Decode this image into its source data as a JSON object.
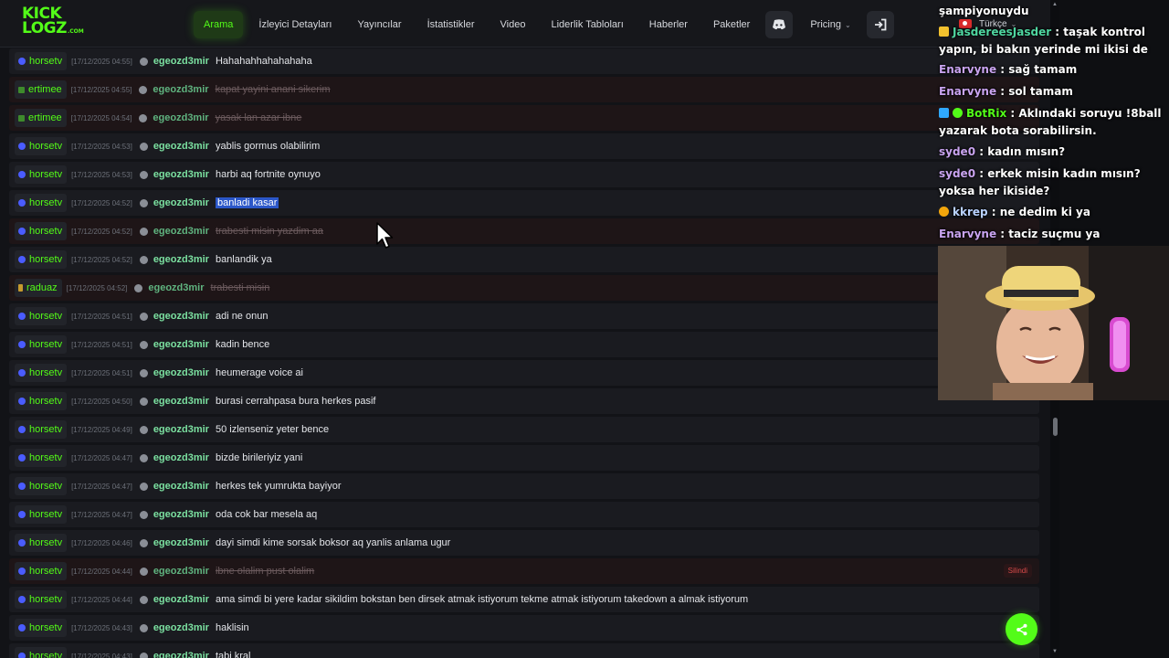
{
  "site": {
    "logo": {
      "line1": "KICK",
      "line2": "LOGZ",
      "suffix": ".COM"
    },
    "nav": [
      {
        "label": "Arama",
        "active": true
      },
      {
        "label": "İzleyici Detayları"
      },
      {
        "label": "Yayıncılar"
      },
      {
        "label": "İstatistikler"
      },
      {
        "label": "Video"
      },
      {
        "label": "Liderlik Tabloları"
      },
      {
        "label": "Haberler"
      },
      {
        "label": "Paketler"
      }
    ],
    "nav_pricing": "Pricing",
    "language": "Türkçe",
    "deleted_label": "Silindi",
    "icons": {
      "discord": "discord-icon",
      "login": "login-icon",
      "share": "share-icon",
      "info": "info-icon"
    }
  },
  "messages": [
    {
      "channel": "horsetv",
      "time": "[17/12/2025 04:55]",
      "user": "egeozd3mir",
      "text": "Hahahahhahahahaha",
      "deleted": false
    },
    {
      "channel": "ertimee",
      "time": "[17/12/2025 04:55]",
      "user": "egeozd3mir",
      "text": "kapat yayini anani sikerim",
      "deleted": true
    },
    {
      "channel": "ertimee",
      "time": "[17/12/2025 04:54]",
      "user": "egeozd3mir",
      "text": "yasak lan azar ibne",
      "deleted": true
    },
    {
      "channel": "horsetv",
      "time": "[17/12/2025 04:53]",
      "user": "egeozd3mir",
      "text": "yablis gormus olabilirim",
      "deleted": false
    },
    {
      "channel": "horsetv",
      "time": "[17/12/2025 04:53]",
      "user": "egeozd3mir",
      "text": "harbi aq fortnite oynuyo",
      "deleted": false
    },
    {
      "channel": "horsetv",
      "time": "[17/12/2025 04:52]",
      "user": "egeozd3mir",
      "text": "banladi kasar",
      "deleted": false,
      "highlight": true
    },
    {
      "channel": "horsetv",
      "time": "[17/12/2025 04:52]",
      "user": "egeozd3mir",
      "text": "trabesti misin yazdim aa",
      "deleted": true
    },
    {
      "channel": "horsetv",
      "time": "[17/12/2025 04:52]",
      "user": "egeozd3mir",
      "text": "banlandik ya",
      "deleted": false
    },
    {
      "channel": "raduaz",
      "time": "[17/12/2025 04:52]",
      "user": "egeozd3mir",
      "text": "trabesti misin",
      "deleted": true
    },
    {
      "channel": "horsetv",
      "time": "[17/12/2025 04:51]",
      "user": "egeozd3mir",
      "text": "adi ne onun",
      "deleted": false
    },
    {
      "channel": "horsetv",
      "time": "[17/12/2025 04:51]",
      "user": "egeozd3mir",
      "text": "kadin bence",
      "deleted": false
    },
    {
      "channel": "horsetv",
      "time": "[17/12/2025 04:51]",
      "user": "egeozd3mir",
      "text": "heumerage voice ai",
      "deleted": false
    },
    {
      "channel": "horsetv",
      "time": "[17/12/2025 04:50]",
      "user": "egeozd3mir",
      "text": "burasi cerrahpasa bura herkes pasif",
      "deleted": false
    },
    {
      "channel": "horsetv",
      "time": "[17/12/2025 04:49]",
      "user": "egeozd3mir",
      "text": "50 izlenseniz yeter bence",
      "deleted": false
    },
    {
      "channel": "horsetv",
      "time": "[17/12/2025 04:47]",
      "user": "egeozd3mir",
      "text": "bizde birileriyiz yani",
      "deleted": false
    },
    {
      "channel": "horsetv",
      "time": "[17/12/2025 04:47]",
      "user": "egeozd3mir",
      "text": "herkes tek yumrukta bayiyor",
      "deleted": false
    },
    {
      "channel": "horsetv",
      "time": "[17/12/2025 04:47]",
      "user": "egeozd3mir",
      "text": "oda cok bar mesela aq",
      "deleted": false
    },
    {
      "channel": "horsetv",
      "time": "[17/12/2025 04:46]",
      "user": "egeozd3mir",
      "text": "dayi simdi kime sorsak boksor aq yanlis anlama ugur",
      "deleted": false
    },
    {
      "channel": "horsetv",
      "time": "[17/12/2025 04:44]",
      "user": "egeozd3mir",
      "text": "ibne olalim pust olalim",
      "deleted": true,
      "show_deleted_tag": true
    },
    {
      "channel": "horsetv",
      "time": "[17/12/2025 04:44]",
      "user": "egeozd3mir",
      "text": "ama simdi bi yere kadar sikildim bokstan ben dirsek atmak istiyorum tekme atmak istiyorum takedown a almak istiyorum",
      "deleted": false
    },
    {
      "channel": "horsetv",
      "time": "[17/12/2025 04:43]",
      "user": "egeozd3mir",
      "text": "haklisin",
      "deleted": false
    },
    {
      "channel": "horsetv",
      "time": "[17/12/2025 04:43]",
      "user": "egeozd3mir",
      "text": "tabi kral",
      "deleted": false
    }
  ],
  "overlay_chat": [
    {
      "user": "",
      "text": "şampiyonuydu",
      "color": "#ffffff",
      "badges": []
    },
    {
      "user": "JasdereesJasder",
      "text": " : taşak kontrol yapın, bi bakın yerinde mi ikisi de",
      "color": "#4fd6a0",
      "badges": [
        "crown-badge-icon"
      ]
    },
    {
      "user": "Enarvyne",
      "text": " : sağ tamam",
      "color": "#c9a4f0",
      "badges": []
    },
    {
      "user": "Enarvyne",
      "text": " : sol tamam",
      "color": "#c9a4f0",
      "badges": []
    },
    {
      "user": "BotRix",
      "text": " : Aklındaki soruyu !8ball yazarak bota sorabilirsin.",
      "color": "#53fc18",
      "badges": [
        "bot-badge-icon",
        "verified-badge-icon"
      ]
    },
    {
      "user": "syde0",
      "text": " : kadın mısın?",
      "color": "#c9a4f0",
      "badges": []
    },
    {
      "user": "syde0",
      "text": " : erkek misin kadın mısın? yoksa her ikiside?",
      "color": "#c9a4f0",
      "badges": []
    },
    {
      "user": "kkrep",
      "text": " : ne dedim ki ya",
      "color": "#b9d2ff",
      "badges": [
        "gift-badge-icon"
      ]
    },
    {
      "user": "Enarvyne",
      "text": " : taciz suçmu ya",
      "color": "#c9a4f0",
      "badges": []
    }
  ],
  "colors": {
    "accent": "#53fc18",
    "row_bg": "#1a1b20",
    "row_deleted_bg": "#1e1517",
    "highlight": "#2b57c9"
  }
}
